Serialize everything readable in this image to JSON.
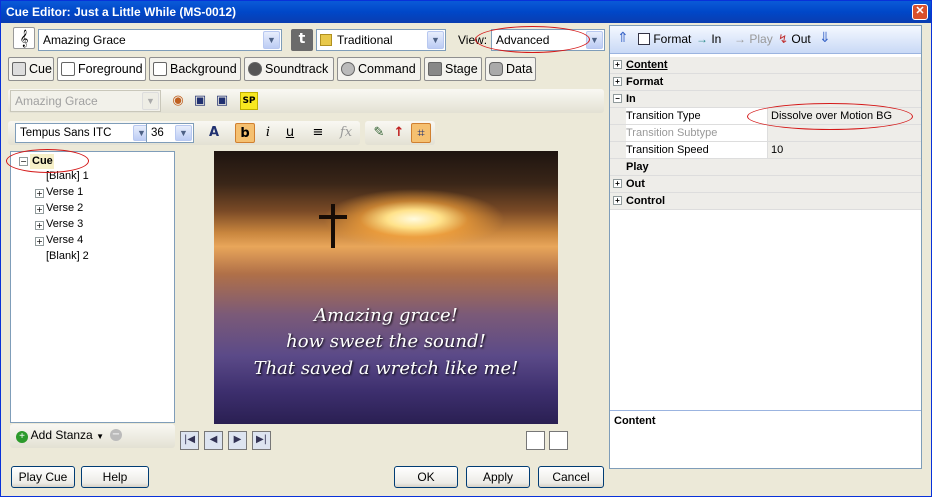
{
  "window": {
    "title": "Cue Editor: Just a Little While (MS-0012)"
  },
  "header": {
    "song_value": "Amazing Grace",
    "style_value": "Traditional",
    "view_label": "View:",
    "view_value": "Advanced"
  },
  "tabs": [
    {
      "label": "Cue"
    },
    {
      "label": "Foreground"
    },
    {
      "label": "Background"
    },
    {
      "label": "Soundtrack"
    },
    {
      "label": "Command"
    },
    {
      "label": "Stage"
    },
    {
      "label": "Data"
    }
  ],
  "toolbar2": {
    "disabled_combo": "Amazing Grace",
    "sp_label": "SP"
  },
  "format_bar": {
    "font": "Tempus Sans ITC",
    "size": "36",
    "bold": "b",
    "italic": "i",
    "underline": "u",
    "fx": "fx",
    "font_color_label": "A"
  },
  "tree": {
    "root": "Cue",
    "items": [
      "[Blank] 1",
      "Verse 1",
      "Verse 2",
      "Verse 3",
      "Verse 4",
      "[Blank] 2"
    ]
  },
  "tree_footer": {
    "add_stanza": "Add Stanza"
  },
  "slide": {
    "lines": [
      "Amazing grace!",
      "how sweet the sound!",
      "That saved a wretch like me!"
    ]
  },
  "bottom_buttons": {
    "play_cue": "Play Cue",
    "help": "Help",
    "ok": "OK",
    "apply": "Apply",
    "cancel": "Cancel"
  },
  "right_toolbar": {
    "format": "Format",
    "in": "In",
    "play": "Play",
    "out": "Out"
  },
  "properties": {
    "content": "Content",
    "format": "Format",
    "in": "In",
    "transition_type_label": "Transition Type",
    "transition_type_value": "Dissolve over Motion BG",
    "transition_subtype_label": "Transition Subtype",
    "transition_speed_label": "Transition Speed",
    "transition_speed_value": "10",
    "play": "Play",
    "out": "Out",
    "control": "Control"
  },
  "description": {
    "title": "Content"
  },
  "colors": {
    "accent": "#0a246a",
    "annotation": "#d41818",
    "titlebar": "#0047c8"
  }
}
